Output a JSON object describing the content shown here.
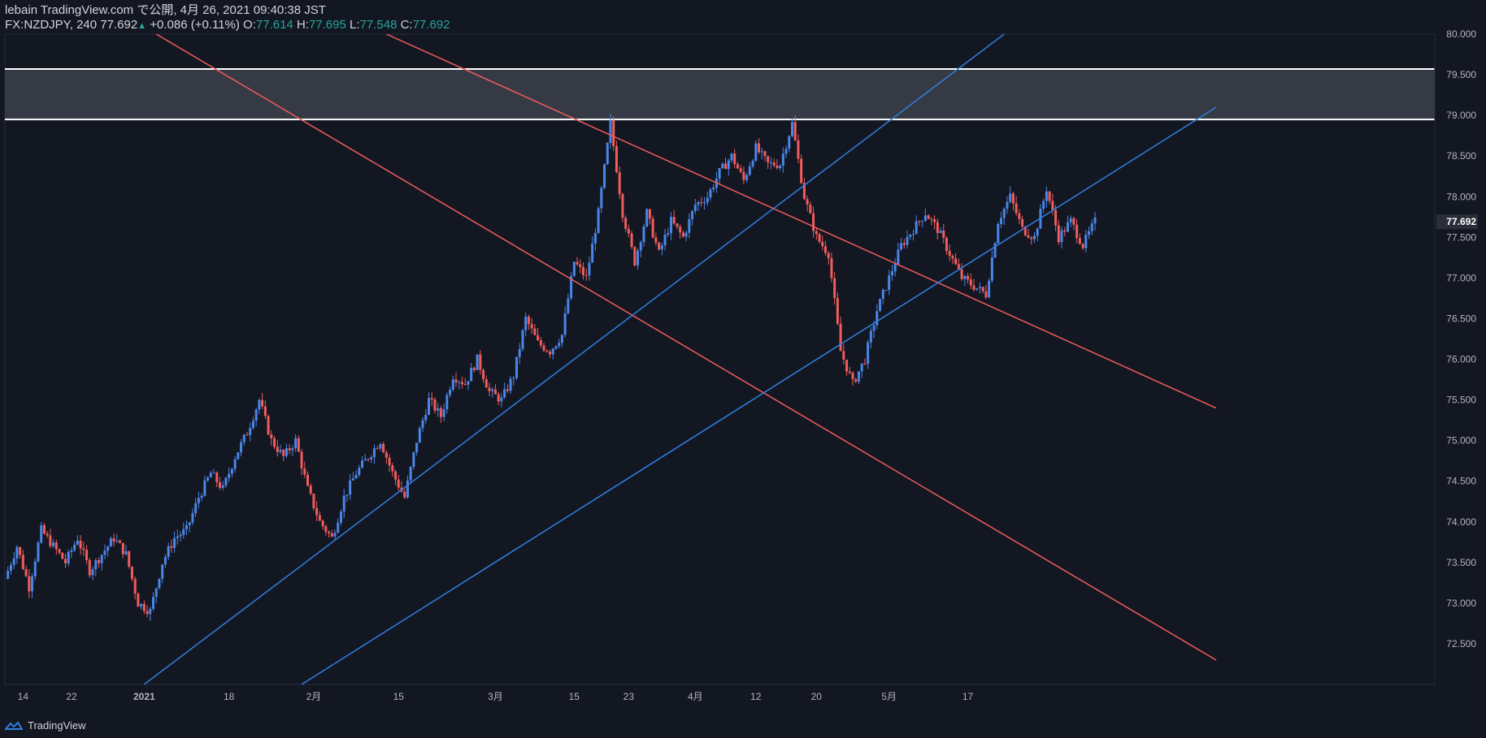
{
  "header": {
    "line1": "lebain TradingView.com で公開, 4月 26, 2021 09:40:38 JST",
    "symbol": "FX:NZDJPY, 240",
    "last": "77.692",
    "change": "+0.086 (+0.11%)",
    "o_label": "O:",
    "o_value": "77.614",
    "h_label": "H:",
    "h_value": "77.695",
    "l_label": "L:",
    "l_value": "77.548",
    "c_label": "C:",
    "c_value": "77.692"
  },
  "footer": {
    "brand": "TradingView"
  },
  "colors": {
    "background": "#131722",
    "up": "#4a86e8",
    "down": "#f05c5c",
    "red_line": "#f05c5c",
    "blue_line": "#2f7fe0",
    "zone": "#363a45"
  },
  "chart_data": {
    "type": "candlestick",
    "symbol": "FX:NZDJPY",
    "interval": "240",
    "ylim": [
      72.0,
      80.0
    ],
    "y_ticks": [
      "80.000",
      "79.500",
      "79.000",
      "78.500",
      "78.000",
      "77.500",
      "77.000",
      "76.500",
      "76.000",
      "75.500",
      "75.000",
      "74.500",
      "74.000",
      "73.500",
      "73.000",
      "72.500"
    ],
    "x_ticks": [
      "14",
      "22",
      "2021",
      "18",
      "2月",
      "15",
      "3月",
      "15",
      "23",
      "4月",
      "12",
      "20",
      "5月",
      "17"
    ],
    "last_price_label": "77.692",
    "resistance_zone": [
      78.95,
      79.57
    ],
    "price_path": [
      [
        0,
        73.3
      ],
      [
        2,
        73.7
      ],
      [
        4,
        73.2
      ],
      [
        6,
        73.9
      ],
      [
        8,
        73.7
      ],
      [
        10,
        73.5
      ],
      [
        12,
        73.8
      ],
      [
        14,
        73.4
      ],
      [
        16,
        73.6
      ],
      [
        18,
        73.8
      ],
      [
        20,
        73.6
      ],
      [
        22,
        73.0
      ],
      [
        24,
        72.9
      ],
      [
        26,
        73.5
      ],
      [
        28,
        73.8
      ],
      [
        30,
        73.9
      ],
      [
        32,
        74.3
      ],
      [
        34,
        74.6
      ],
      [
        36,
        74.4
      ],
      [
        38,
        74.8
      ],
      [
        40,
        75.1
      ],
      [
        42,
        75.5
      ],
      [
        44,
        75.0
      ],
      [
        46,
        74.8
      ],
      [
        48,
        75.0
      ],
      [
        50,
        74.4
      ],
      [
        52,
        74.0
      ],
      [
        54,
        73.8
      ],
      [
        56,
        74.3
      ],
      [
        58,
        74.6
      ],
      [
        60,
        74.8
      ],
      [
        62,
        75.0
      ],
      [
        64,
        74.6
      ],
      [
        66,
        74.3
      ],
      [
        68,
        75.0
      ],
      [
        70,
        75.5
      ],
      [
        72,
        75.3
      ],
      [
        74,
        75.8
      ],
      [
        76,
        75.7
      ],
      [
        78,
        76.0
      ],
      [
        80,
        75.6
      ],
      [
        82,
        75.5
      ],
      [
        84,
        75.8
      ],
      [
        86,
        76.5
      ],
      [
        88,
        76.2
      ],
      [
        90,
        76.1
      ],
      [
        92,
        76.3
      ],
      [
        94,
        77.2
      ],
      [
        96,
        77.0
      ],
      [
        98,
        77.8
      ],
      [
        100,
        78.9
      ],
      [
        102,
        77.8
      ],
      [
        104,
        77.2
      ],
      [
        106,
        77.8
      ],
      [
        108,
        77.3
      ],
      [
        110,
        77.7
      ],
      [
        112,
        77.5
      ],
      [
        114,
        77.9
      ],
      [
        116,
        78.0
      ],
      [
        118,
        78.3
      ],
      [
        120,
        78.5
      ],
      [
        122,
        78.2
      ],
      [
        124,
        78.6
      ],
      [
        126,
        78.4
      ],
      [
        128,
        78.4
      ],
      [
        130,
        78.9
      ],
      [
        132,
        78.0
      ],
      [
        134,
        77.5
      ],
      [
        136,
        77.3
      ],
      [
        138,
        76.1
      ],
      [
        140,
        75.7
      ],
      [
        142,
        76.0
      ],
      [
        144,
        76.6
      ],
      [
        146,
        77.0
      ],
      [
        148,
        77.4
      ],
      [
        150,
        77.6
      ],
      [
        152,
        77.8
      ],
      [
        154,
        77.6
      ],
      [
        156,
        77.3
      ],
      [
        158,
        77.0
      ],
      [
        160,
        76.9
      ],
      [
        162,
        76.8
      ],
      [
        164,
        77.7
      ],
      [
        166,
        78.0
      ],
      [
        168,
        77.6
      ],
      [
        170,
        77.5
      ],
      [
        172,
        78.1
      ],
      [
        174,
        77.5
      ],
      [
        176,
        77.7
      ],
      [
        178,
        77.4
      ],
      [
        180,
        77.692
      ]
    ],
    "trendlines": [
      {
        "color": "red",
        "x1": 25,
        "y1": 80.0,
        "x2": 200,
        "y2": 72.3
      },
      {
        "color": "red",
        "x1": 63,
        "y1": 80.0,
        "x2": 200,
        "y2": 75.4
      },
      {
        "color": "blue",
        "x1": 23,
        "y1": 72.0,
        "x2": 165,
        "y2": 80.0
      },
      {
        "color": "blue",
        "x1": 49,
        "y1": 72.0,
        "x2": 200,
        "y2": 79.1
      }
    ],
    "x_tick_positions": [
      3,
      11,
      23,
      37,
      51,
      65,
      81,
      94,
      103,
      114,
      124,
      134,
      146,
      159
    ]
  }
}
